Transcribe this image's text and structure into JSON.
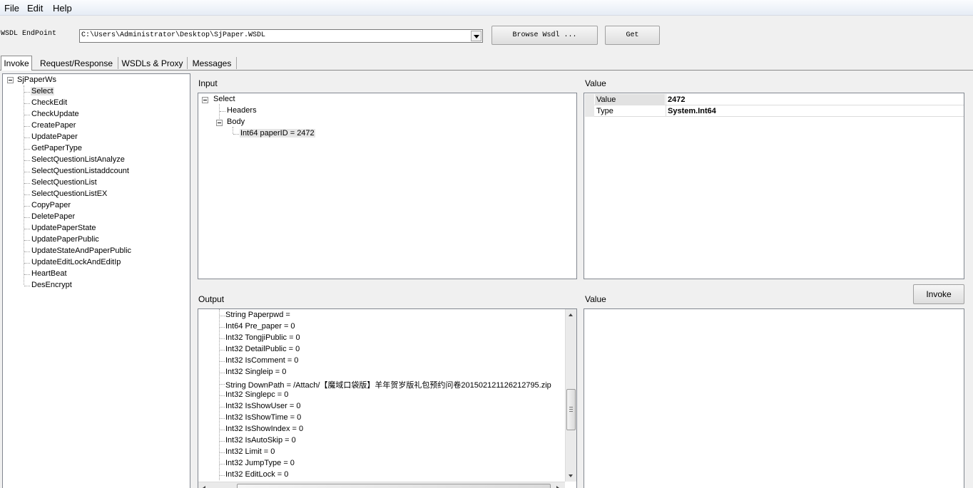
{
  "menu": [
    "File",
    "Edit",
    "Help"
  ],
  "endpoint": {
    "label": "WSDL EndPoint",
    "value": "C:\\Users\\Administrator\\Desktop\\SjPaper.WSDL",
    "browse_label": "Browse Wsdl ...",
    "get_label": "Get"
  },
  "tabs": [
    "Invoke",
    "Request/Response",
    "WSDLs & Proxy",
    "Messages"
  ],
  "methods": {
    "root": "SjPaperWs",
    "selected": "Select",
    "items": [
      "Select",
      "CheckEdit",
      "CheckUpdate",
      "CreatePaper",
      "UpdatePaper",
      "GetPaperType",
      "SelectQuestionListAnalyze",
      "SelectQuestionListaddcount",
      "SelectQuestionList",
      "SelectQuestionListEX",
      "CopyPaper",
      "DeletePaper",
      "UpdatePaperState",
      "UpdatePaperPublic",
      "UpdateStateAndPaperPublic",
      "UpdateEditLockAndEditIp",
      "HeartBeat",
      "DesEncrypt"
    ]
  },
  "input": {
    "label": "Input",
    "root": "Select",
    "headers": "Headers",
    "body": "Body",
    "param": "Int64 paperID = 2472"
  },
  "input_value": {
    "label": "Value",
    "rows": [
      {
        "name": "Value",
        "value": "2472"
      },
      {
        "name": "Type",
        "value": "System.Int64"
      }
    ]
  },
  "invoke_label": "Invoke",
  "output": {
    "label": "Output",
    "items": [
      "String Paperpwd =",
      "Int64 Pre_paper = 0",
      "Int32 TongjiPublic = 0",
      "Int32 DetailPublic = 0",
      "Int32 IsComment = 0",
      "Int32 Singleip = 0",
      "String DownPath = /Attach/【魔域口袋版】羊年贺岁版礼包预约问卷201502121126212795.zip",
      "Int32 Singlepc = 0",
      "Int32 IsShowUser = 0",
      "Int32 IsShowTime = 0",
      "Int32 IsShowIndex = 0",
      "Int32 IsAutoSkip = 0",
      "Int32 Limit = 0",
      "Int32 JumpType = 0",
      "Int32 EditLock = 0"
    ]
  },
  "output_value": {
    "label": "Value"
  }
}
